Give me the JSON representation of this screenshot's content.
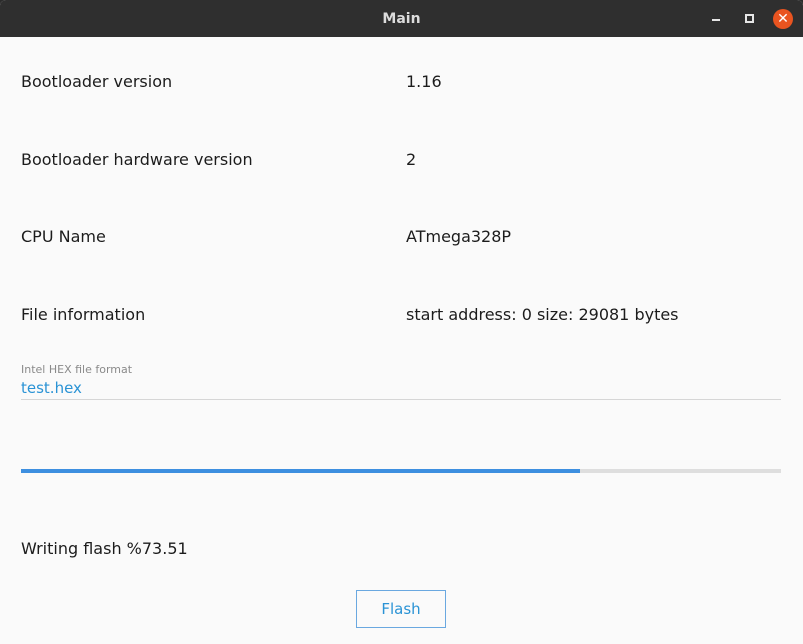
{
  "window": {
    "title": "Main",
    "close_glyph": "✕"
  },
  "info_rows": [
    {
      "label": "Bootloader version",
      "value": "1.16"
    },
    {
      "label": "Bootloader hardware version",
      "value": "2"
    },
    {
      "label": "CPU Name",
      "value": "ATmega328P"
    },
    {
      "label": "File information",
      "value": "start address: 0 size: 29081 bytes"
    }
  ],
  "file_field": {
    "label": "Intel HEX file format",
    "value": "test.hex"
  },
  "progress": {
    "fraction": 0.7351
  },
  "status_text": "Writing flash %73.51",
  "flash_button": {
    "label": "Flash"
  },
  "colors": {
    "accent": "#2a93d5",
    "progress_fill": "#3d8fe0",
    "close_button": "#e95420",
    "titlebar": "#2f2f2f"
  },
  "icons": {
    "minimize": "minimize-icon",
    "maximize": "maximize-icon",
    "close": "close-icon"
  }
}
